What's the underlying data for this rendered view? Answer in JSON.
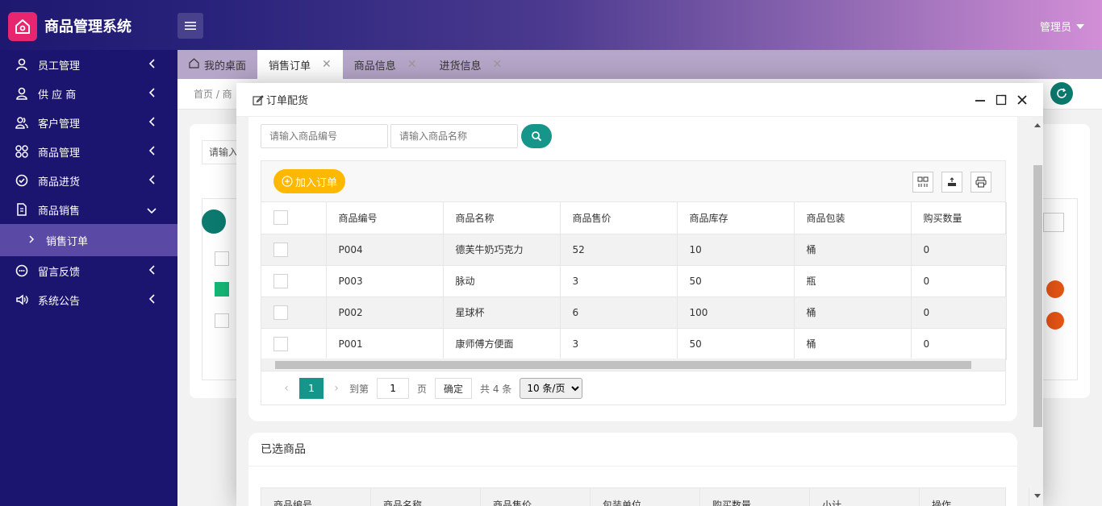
{
  "app": {
    "title": "商品管理系统",
    "user": "管理员"
  },
  "sidebar": {
    "items": [
      {
        "label": "员工管理"
      },
      {
        "label": "供 应 商"
      },
      {
        "label": "客户管理"
      },
      {
        "label": "商品管理"
      },
      {
        "label": "商品进货"
      },
      {
        "label": "商品销售"
      },
      {
        "label": "留言反馈"
      },
      {
        "label": "系统公告"
      }
    ],
    "sub_item": "销售订单"
  },
  "tabs": [
    {
      "label": "我的桌面"
    },
    {
      "label": "销售订单"
    },
    {
      "label": "商品信息"
    },
    {
      "label": "进货信息"
    }
  ],
  "background_page": {
    "breadcrumb": "首页 / 商",
    "search_partial": "请输入"
  },
  "modal": {
    "title": "订单配货",
    "search": {
      "code_placeholder": "请输入商品编号",
      "name_placeholder": "请输入商品名称"
    },
    "add_order_label": "加入订单",
    "columns": [
      "商品编号",
      "商品名称",
      "商品售价",
      "商品库存",
      "商品包装",
      "购买数量"
    ],
    "rows": [
      {
        "code": "P004",
        "name": "德芙牛奶巧克力",
        "price": "52",
        "stock": "10",
        "pack": "桶",
        "qty": "0"
      },
      {
        "code": "P003",
        "name": "脉动",
        "price": "3",
        "stock": "50",
        "pack": "瓶",
        "qty": "0"
      },
      {
        "code": "P002",
        "name": "星球杯",
        "price": "6",
        "stock": "100",
        "pack": "桶",
        "qty": "0"
      },
      {
        "code": "P001",
        "name": "康师傅方便面",
        "price": "3",
        "stock": "50",
        "pack": "桶",
        "qty": "0"
      }
    ],
    "pager": {
      "current": "1",
      "goto_label": "到第",
      "goto_value": "1",
      "page_label": "页",
      "confirm": "确定",
      "total": "共 4 条",
      "page_size": "10 条/页"
    },
    "selected": {
      "title": "已选商品",
      "columns": [
        "商品编号",
        "商品名称",
        "商品售价",
        "包装单位",
        "购买数量",
        "小计",
        "操作"
      ]
    }
  },
  "colors": {
    "accent": "#16968a",
    "sidebar": "#1b1570",
    "warning": "#ffb800"
  }
}
